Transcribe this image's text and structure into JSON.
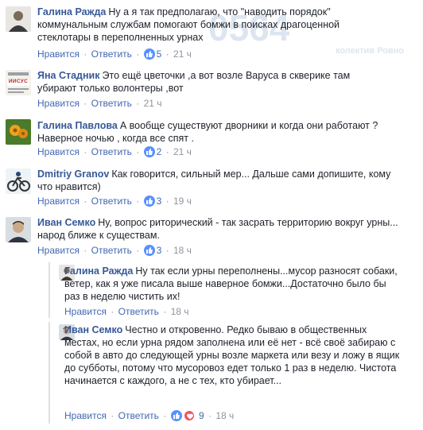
{
  "watermark": {
    "main": "0564",
    "sub": "колектив Ровно"
  },
  "actions": {
    "like": "Нравится",
    "reply": "Ответить",
    "dot": "·"
  },
  "colors": {
    "link": "#365899",
    "action": "#4267b2",
    "meta": "#90949c",
    "like": "#5890ff",
    "love": "#f25268"
  },
  "comments": [
    {
      "author": "Галина Ражда",
      "text": "Ну а я так предполагаю, что \"наводить порядок\" коммунальным службам помогают бомжи в поисках драгоценной стеклотары в переполненных урнах",
      "reactions": "5",
      "time": "21 ч",
      "avatar_icon": "person-photo"
    },
    {
      "author": "Яна Стадник",
      "text": "Это ещё цветочки ,а вот возле Варуса в скверике там убирают только волонтеры ,вот",
      "reactions": "",
      "time": "21 ч",
      "avatar_icon": "poster-photo",
      "avatar_text": "ИИСУС"
    },
    {
      "author": "Галина Павлова",
      "text": "А вообще существуют дворники и когда они работают ? Наверное ночью , когда все спят .",
      "reactions": "2",
      "time": "21 ч",
      "avatar_icon": "flower-photo"
    },
    {
      "author": "Dmitriy Granov",
      "text": "Как говорится, сильный мер... Дальше сами допишите, кому что нравится)",
      "reactions": "3",
      "time": "19 ч",
      "avatar_icon": "bicycle-photo"
    },
    {
      "author": "Иван Семко",
      "text": "Ну, вопрос риторический - так засрать территорию вокруг урны... народ ближе к существам.",
      "reactions": "3",
      "time": "18 ч",
      "avatar_icon": "man-photo"
    }
  ],
  "replies": [
    {
      "author": "Галина Ражда",
      "text": "Ну так если урны переполнены...мусор разносят собаки, ветер, как я уже писала выше наверное бомжи...Достаточно было бы раз в неделю чистить их!",
      "reactions": "",
      "time": "18 ч",
      "avatar_icon": "person-photo"
    },
    {
      "author": "Иван Семко",
      "text": "Честно и откровенно. Редко бываю в общественных местах, но если урна рядом заполнена или её нет - всё своё забираю с собой в авто до следующей урны возле маркета или везу и ложу в ящик до субботы, потому что мусоровоз едет только 1 раз в неделю. Чистота начинается с каждого, а не с тех, кто убирает...",
      "reactions": "9",
      "time": "18 ч",
      "avatar_icon": "man-photo"
    }
  ]
}
